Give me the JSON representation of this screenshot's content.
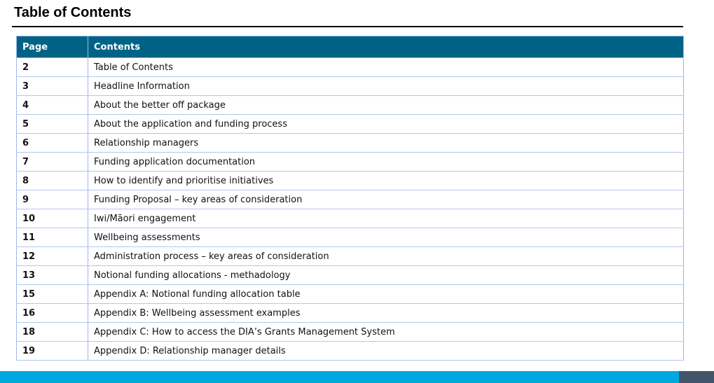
{
  "title": "Table of Contents",
  "table": {
    "headers": [
      "Page",
      "Contents"
    ],
    "rows": [
      {
        "page": "2",
        "contents": "Table of Contents"
      },
      {
        "page": "3",
        "contents": "Headline Information"
      },
      {
        "page": "4",
        "contents": "About the better off package"
      },
      {
        "page": "5",
        "contents": "About the application and funding process"
      },
      {
        "page": "6",
        "contents": "Relationship managers"
      },
      {
        "page": "7",
        "contents": "Funding application documentation"
      },
      {
        "page": "8",
        "contents": "How to identify and prioritise initiatives"
      },
      {
        "page": "9",
        "contents": "Funding Proposal – key areas of consideration"
      },
      {
        "page": "10",
        "contents": "Iwi/Māori engagement"
      },
      {
        "page": "11",
        "contents": "Wellbeing assessments"
      },
      {
        "page": "12",
        "contents": "Administration process – key areas of consideration"
      },
      {
        "page": "13",
        "contents": "Notional funding allocations - methadology"
      },
      {
        "page": "15",
        "contents": "Appendix A: Notional funding allocation table"
      },
      {
        "page": "16",
        "contents": "Appendix B: Wellbeing assessment examples"
      },
      {
        "page": "18",
        "contents": "Appendix C: How to access the DIA’s Grants Management System"
      },
      {
        "page": "19",
        "contents": "Appendix D: Relationship manager details"
      }
    ]
  },
  "colors": {
    "header": "#006385",
    "footer_bar": "#00a8e1",
    "footer_block": "#44546a"
  }
}
